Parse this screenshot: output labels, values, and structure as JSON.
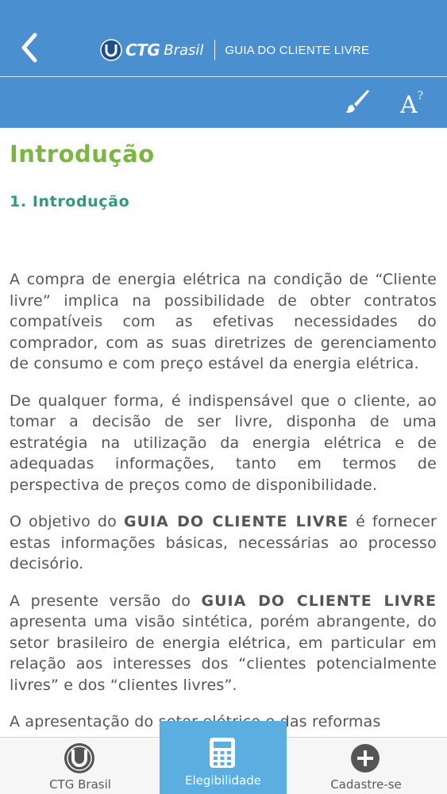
{
  "header": {
    "logo_brand": "CTG",
    "logo_country": "Brasil",
    "app_title": "GUIA DO CLIENTE LIVRE",
    "back_icon": "chevron-left-icon"
  },
  "toolbar": {
    "theme_icon": "brush-icon",
    "font_size_icon": "font-size-icon",
    "font_size_label": "A",
    "font_size_sup": "?"
  },
  "content": {
    "page_title": "Introdução",
    "section_title": "1. Introdução",
    "paragraphs": [
      {
        "text": "A compra de energia elétrica na condição de “Cliente livre” implica na possibilidade de obter contratos compatíveis com as efetivas necessidades do comprador, com as suas diretrizes de gerenciamento de consumo e com preço estável da energia elétrica."
      },
      {
        "text": "De qualquer forma, é indispensável que o cliente, ao tomar a decisão de ser livre, disponha de uma estratégia na utilização da energia elétrica e de adequadas informações, tanto em termos de perspectiva de preços como de disponibilidade."
      },
      {
        "before": "O objetivo do ",
        "bold": "GUIA DO CLIENTE LIVRE",
        "after": " é fornecer estas informações básicas, necessárias ao processo decisório."
      },
      {
        "before": "A presente versão do ",
        "bold": "GUIA DO CLIENTE LIVRE",
        "after": " apresenta uma visão sintética, porém abrangente, do setor brasileiro de energia elétrica, em particular em relação aos interesses dos “clientes potencialmente livres” e dos “clientes livres”."
      },
      {
        "text": "A apresentação do setor elétrico e das reformas"
      }
    ]
  },
  "bottom_nav": {
    "tabs": [
      {
        "label": "CTG Brasil",
        "icon": "ctg-logo-icon",
        "active": false
      },
      {
        "label": "Elegibilidade",
        "icon": "calculator-icon",
        "active": true
      },
      {
        "label": "Cadastre-se",
        "icon": "plus-circle-icon",
        "active": false
      }
    ]
  },
  "colors": {
    "header_bg": "#4a8fcf",
    "title_green": "#7bb543",
    "section_teal": "#2e9c78",
    "body_text": "#555555",
    "active_tab_bg": "#5aaee0"
  }
}
